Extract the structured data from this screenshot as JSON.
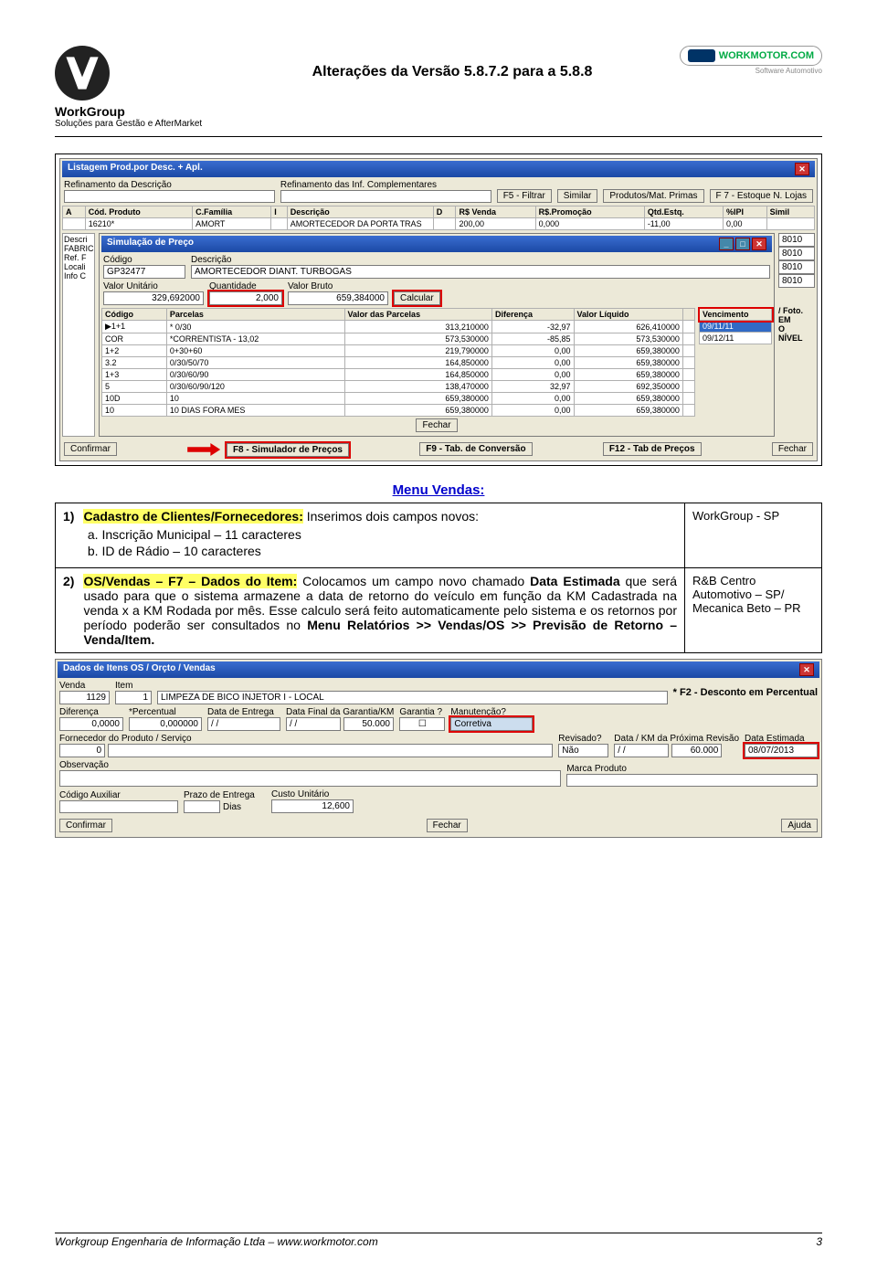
{
  "header": {
    "company": "WorkGroup",
    "company_sub": "Soluções para Gestão e AfterMarket",
    "title": "Alterações da Versão 5.8.7.2 para a 5.8.8",
    "wm_logo_text": "WORKMOTOR.COM",
    "wm_logo_sub": "Software Automotivo"
  },
  "screenshot1": {
    "listing_title": "Listagem Prod.por Desc. + Apl.",
    "ref1": "Refinamento da Descrição",
    "ref2": "Refinamento das Inf. Complementares",
    "btns": {
      "f5": "F5 - Filtrar",
      "similar": "Similar",
      "prod": "Produtos/Mat. Primas",
      "f7": "F 7 - Estoque N. Lojas"
    },
    "cols": [
      "A",
      "Cód. Produto",
      "C.Família",
      "I",
      "Descrição",
      "D",
      "R$ Venda",
      "R$.Promoção",
      "Qtd.Estq.",
      "%IPI",
      "Simil"
    ],
    "row1": [
      "",
      "16210*",
      "AMORT",
      "",
      "AMORTECEDOR DA PORTA TRAS",
      "",
      "200,00",
      "0,000",
      "-11,00",
      "0,00",
      ""
    ],
    "sim_title": "Simulação de Preço",
    "sim_labels": {
      "codigo": "Código",
      "descricao": "Descrição",
      "valor_unit": "Valor Unitário",
      "qtd": "Quantidade",
      "valor_bruto": "Valor Bruto",
      "calcular": "Calcular"
    },
    "sim_vals": {
      "codigo": "GP32477",
      "descricao": "AMORTECEDOR DIANT. TURBOGAS",
      "valor_unit": "329,692000",
      "qtd": "2,000",
      "valor_bruto": "659,384000"
    },
    "sim_cols": [
      "Código",
      "Parcelas",
      "Valor das Parcelas",
      "Diferença",
      "Valor Líquido",
      "",
      "Vencimento"
    ],
    "sim_rows": [
      [
        "▶1+1",
        "* 0/30",
        "313,210000",
        "-32,97",
        "626,410000",
        "",
        "09/11/11"
      ],
      [
        "COR",
        "*CORRENTISTA - 13,02",
        "573,530000",
        "-85,85",
        "573,530000",
        "",
        "09/12/11"
      ],
      [
        "1+2",
        "0+30+60",
        "219,790000",
        "0,00",
        "659,380000",
        "",
        ""
      ],
      [
        "3.2",
        "0/30/50/70",
        "164,850000",
        "0,00",
        "659,380000",
        "",
        ""
      ],
      [
        "1+3",
        "0/30/60/90",
        "164,850000",
        "0,00",
        "659,380000",
        "",
        ""
      ],
      [
        "5",
        "0/30/60/90/120",
        "138,470000",
        "32,97",
        "692,350000",
        "",
        ""
      ],
      [
        "10D",
        "10",
        "659,380000",
        "0,00",
        "659,380000",
        "",
        ""
      ],
      [
        "10",
        "10 DIAS FORA MES",
        "659,380000",
        "0,00",
        "659,380000",
        "",
        ""
      ]
    ],
    "side_codes": [
      "8010",
      "8010",
      "8010",
      "8010"
    ],
    "side_labels": [
      "Descri",
      "FABRIC",
      "Ref. F",
      "Locali",
      "Info C"
    ],
    "side_right": [
      "/ Foto.",
      "EM",
      "O",
      "NÍVEL"
    ],
    "footer_btns": {
      "confirmar": "Confirmar",
      "f8": "F8 - Simulador de Preços",
      "f9": "F9 - Tab. de Conversão",
      "f12": "F12 - Tab de Preços",
      "fechar": "Fechar",
      "fechar2": "Fechar"
    }
  },
  "menu_vendas": {
    "title": "Menu Vendas:",
    "item1": {
      "num": "1)",
      "lead_hl": "Cadastro de Clientes/Fornecedores:",
      "lead_rest": " Inserimos dois campos novos:",
      "a": "Inscrição Municipal – 11 caracteres",
      "b": "ID de Rádio – 10 caracteres",
      "right": "WorkGroup - SP"
    },
    "item2": {
      "num": "2)",
      "lead_hl": "OS/Vendas – F7 – Dados do Item:",
      "body_a": " Colocamos um campo novo chamado ",
      "bold_a": "Data Estimada",
      "body_b": " que será usado para que o sistema armazene a data de retorno do veículo em função da KM Cadastrada na venda x a KM Rodada por mês. Esse calculo será feito automaticamente pelo sistema e os retornos por período poderão ser consultados no ",
      "bold_b": "Menu Relatórios >> Vendas/OS >> Previsão de Retorno – Venda/Item.",
      "right": "R&B Centro Automotivo – SP/ Mecanica Beto – PR"
    }
  },
  "screenshot2": {
    "title": "Dados de Itens OS / Orçto / Vendas",
    "labels": {
      "venda": "Venda",
      "item": "Item",
      "f2": "* F2 - Desconto em Percentual",
      "diferenca": "Diferença",
      "percentual": "*Percentual",
      "data_entrega": "Data de Entrega",
      "data_final": "Data Final da Garantia/KM",
      "garantia": "Garantia ?",
      "manut": "Manutenção?",
      "fornecedor": "Fornecedor do Produto / Serviço",
      "revisado": "Revisado?",
      "data_km": "Data / KM da Próxima Revisão",
      "data_est": "Data Estimada",
      "obs": "Observação",
      "marca": "Marca Produto",
      "cod_aux": "Código Auxiliar",
      "prazo": "Prazo de Entrega",
      "dias": "Dias",
      "custo": "Custo Unitário",
      "confirmar": "Confirmar",
      "fechar": "Fechar",
      "ajuda": "Ajuda"
    },
    "vals": {
      "venda": "1129",
      "item": "1",
      "desc": "LIMPEZA DE BICO INJETOR I - LOCAL",
      "diferenca": "0,0000",
      "percentual": "0,000000",
      "data_entrega": "  /  /",
      "data_final": "  /  /",
      "data_final_km": "50.000",
      "manut": "Corretiva",
      "fornecedor": "",
      "fornecedor_km": "0",
      "revisado": "Não",
      "data_km_date": "  /  /",
      "data_km_km": "60.000",
      "data_est": "08/07/2013",
      "custo": "12,600"
    }
  },
  "footer": {
    "left": "Workgroup Engenharia de Informação Ltda – www.workmotor.com",
    "right": "3"
  }
}
